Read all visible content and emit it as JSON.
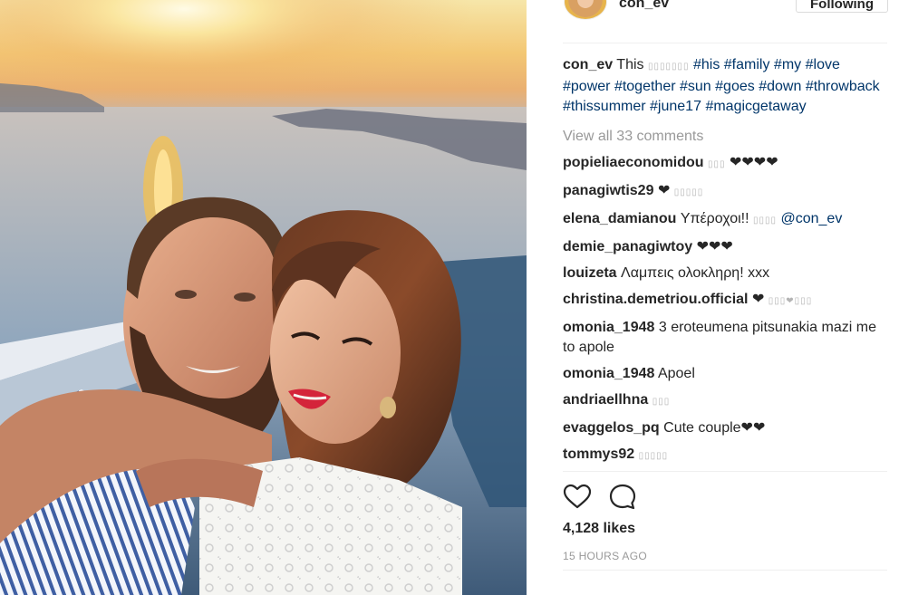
{
  "post": {
    "username": "con_ev",
    "follow_label": "Following",
    "photo_alt": "selfie of a couple at sunset above the sea"
  },
  "caption": {
    "username": "con_ev",
    "text": "This",
    "glyphs": "▯▯▯▯▯▯▯",
    "hashtags": [
      "#his",
      "#family",
      "#my",
      "#love",
      "#power",
      "#together",
      "#sun",
      "#goes",
      "#down",
      "#throwback",
      "#thissummer",
      "#june17",
      "#magicgetaway"
    ]
  },
  "view_all_label": "View all 33 comments",
  "comments": [
    {
      "user": "popieliaeconomidou",
      "glyphs": "▯▯▯",
      "text": "❤❤❤❤",
      "mention": ""
    },
    {
      "user": "panagiwtis29",
      "glyphs": "",
      "text": "❤",
      "after": "▯▯▯▯▯",
      "mention": ""
    },
    {
      "user": "elena_damianou",
      "glyphs": "▯▯▯▯",
      "text": "Υπέροχοι!!",
      "mention": "@con_ev"
    },
    {
      "user": "demie_panagiwtoy",
      "glyphs": "",
      "text": "❤❤❤",
      "mention": ""
    },
    {
      "user": "louizeta",
      "glyphs": "",
      "text": "Λαμπεις ολοκληρη! xxx",
      "mention": ""
    },
    {
      "user": "christina.demetriou.official",
      "glyphs": "",
      "text": "❤",
      "after": "▯▯▯❤▯▯▯",
      "mention": ""
    },
    {
      "user": "omonia_1948",
      "glyphs": "",
      "text": "3 eroteumena pitsunakia mazi me to apole",
      "mention": ""
    },
    {
      "user": "omonia_1948",
      "glyphs": "",
      "text": "Apoel",
      "mention": ""
    },
    {
      "user": "andriaellhna",
      "glyphs": "▯▯▯",
      "text": "",
      "mention": ""
    },
    {
      "user": "evaggelos_pq",
      "glyphs": "",
      "text": "Cute couple❤❤",
      "mention": ""
    },
    {
      "user": "tommys92",
      "glyphs": "▯▯▯▯▯",
      "text": "",
      "mention": ""
    }
  ],
  "actions": {
    "like_icon": "heart-icon",
    "comment_icon": "speech-bubble-icon"
  },
  "likes_label": "4,128 likes",
  "time_label": "15 HOURS AGO",
  "colors": {
    "hashtag": "#003569",
    "muted": "#999999",
    "text": "#262626",
    "divider": "#efefef"
  }
}
